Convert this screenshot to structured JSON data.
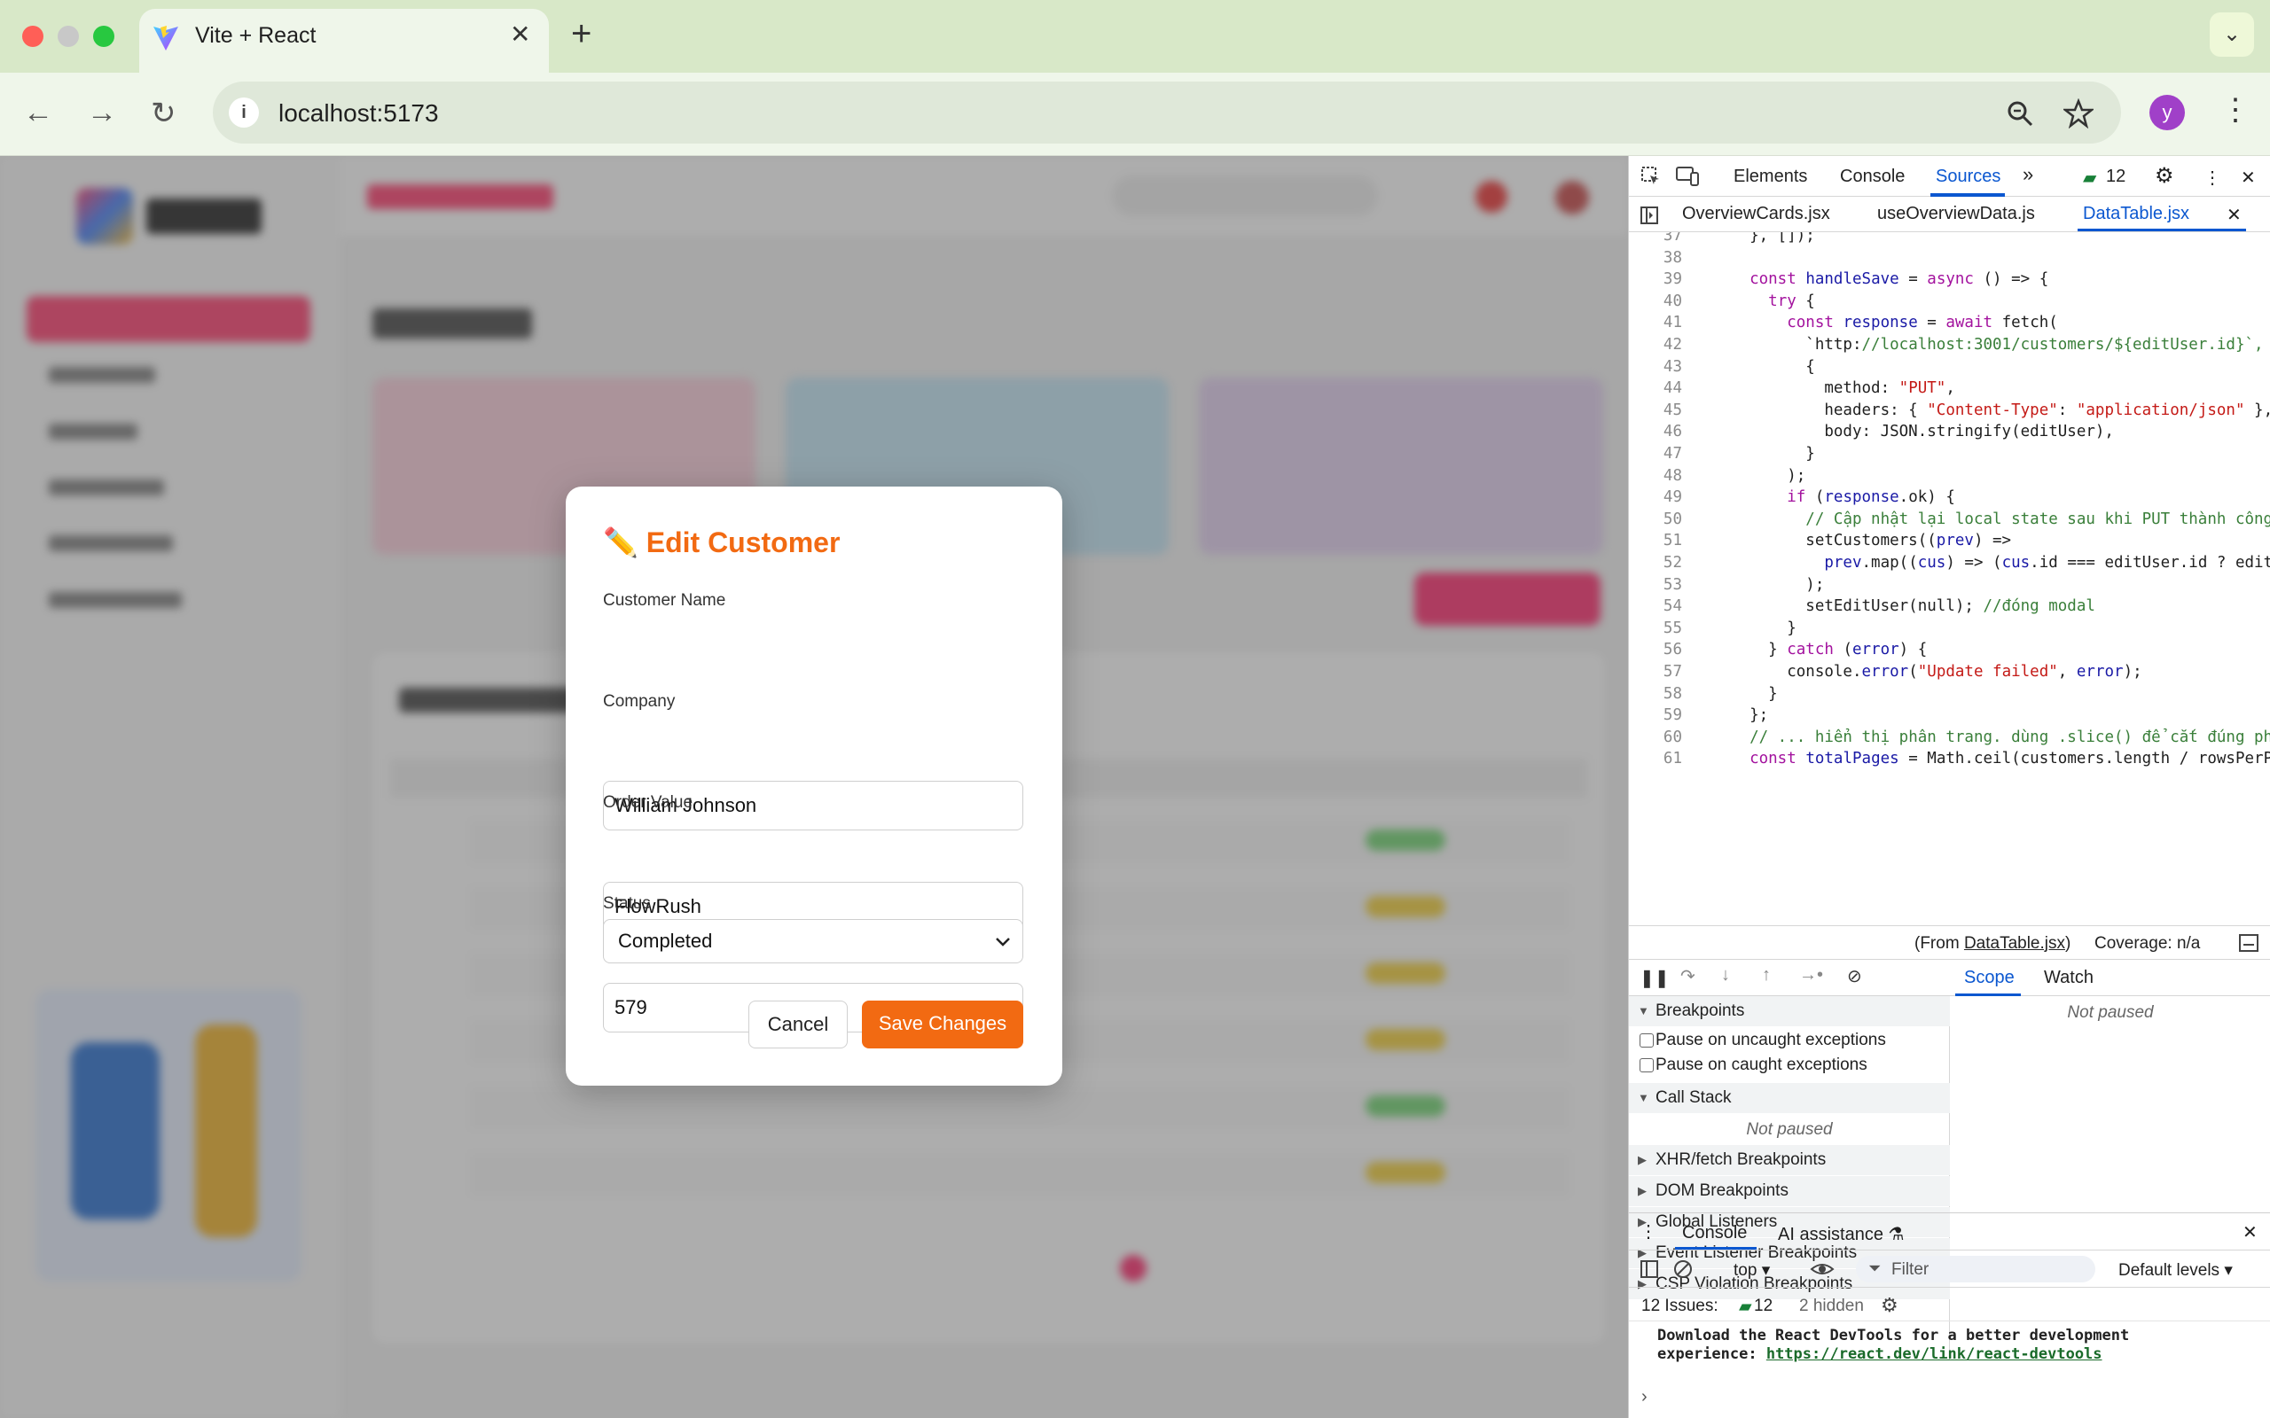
{
  "browser": {
    "tab_title": "Vite + React",
    "url": "localhost:5173",
    "profile_initial": "y"
  },
  "modal": {
    "title": "Edit Customer",
    "fields": {
      "name_label": "Customer Name",
      "name_value": "William Johnson",
      "company_label": "Company",
      "company_value": "FlowRush",
      "order_label": "Order Value",
      "order_value": "579",
      "status_label": "Status",
      "status_value": "Completed"
    },
    "cancel_label": "Cancel",
    "save_label": "Save Changes"
  },
  "devtools": {
    "tabs": [
      "Elements",
      "Console",
      "Sources"
    ],
    "issues_count": "12",
    "files": [
      "OverviewCards.jsx",
      "useOverviewData.js",
      "DataTable.jsx"
    ],
    "code_lines": [
      {
        "n": "37",
        "t": "  }, []);"
      },
      {
        "n": "38",
        "t": ""
      },
      {
        "n": "39",
        "t": "  const handleSave = async () => {"
      },
      {
        "n": "40",
        "t": "    try {"
      },
      {
        "n": "41",
        "t": "      const response = await fetch("
      },
      {
        "n": "42",
        "t": "        `http://localhost:3001/customers/${editUser.id}`,"
      },
      {
        "n": "43",
        "t": "        {"
      },
      {
        "n": "44",
        "t": "          method: \"PUT\","
      },
      {
        "n": "45",
        "t": "          headers: { \"Content-Type\": \"application/json\" },"
      },
      {
        "n": "46",
        "t": "          body: JSON.stringify(editUser),"
      },
      {
        "n": "47",
        "t": "        }"
      },
      {
        "n": "48",
        "t": "      );"
      },
      {
        "n": "49",
        "t": "      if (response.ok) {"
      },
      {
        "n": "50",
        "t": "        // Cập nhật lại local state sau khi PUT thành công"
      },
      {
        "n": "51",
        "t": "        setCustomers((prev) =>"
      },
      {
        "n": "52",
        "t": "          prev.map((cus) => (cus.id === editUser.id ? editUs"
      },
      {
        "n": "53",
        "t": "        );"
      },
      {
        "n": "54",
        "t": "        setEditUser(null); //đóng modal"
      },
      {
        "n": "55",
        "t": "      }"
      },
      {
        "n": "56",
        "t": "    } catch (error) {"
      },
      {
        "n": "57",
        "t": "      console.error(\"Update failed\", error);"
      },
      {
        "n": "58",
        "t": "    }"
      },
      {
        "n": "59",
        "t": "  };"
      },
      {
        "n": "60",
        "t": "  // ... hiển thị phân trang. dùng .slice() để cắt đúng phầ"
      },
      {
        "n": "61",
        "t": "  const totalPages = Math.ceil(customers.length / rowsPerPa"
      }
    ],
    "coverage_from_prefix": "(From ",
    "coverage_file": "DataTable.jsx",
    "coverage_from_suffix": ")",
    "coverage": "Coverage: n/a",
    "scope_tab": "Scope",
    "watch_tab": "Watch",
    "not_paused": "Not paused",
    "breakpoints": "Breakpoints",
    "pause_uncaught": "Pause on uncaught exceptions",
    "pause_caught": "Pause on caught exceptions",
    "call_stack": "Call Stack",
    "sections": [
      "XHR/fetch Breakpoints",
      "DOM Breakpoints",
      "Global Listeners",
      "Event Listener Breakpoints",
      "CSP Violation Breakpoints"
    ],
    "console_tab": "Console",
    "ai_tab": "AI assistance",
    "context": "top",
    "filter_placeholder": "Filter",
    "levels": "Default levels",
    "issues_label": "12 Issues:",
    "hidden": "2 hidden",
    "message_line1": "Download the React DevTools for a better development",
    "message_line2": "experience: ",
    "message_link": "https://react.dev/link/react-devtools"
  }
}
